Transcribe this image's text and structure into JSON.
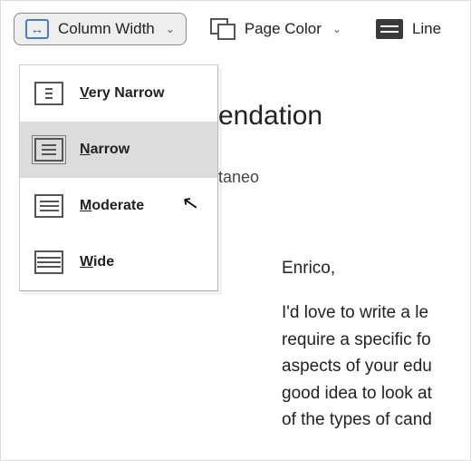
{
  "toolbar": {
    "column_width": {
      "label": "Column Width"
    },
    "page_color": {
      "label": "Page Color"
    },
    "line": {
      "label": "Line"
    }
  },
  "dropdown": {
    "items": [
      {
        "pre": "",
        "ul": "V",
        "rest": "ery Narrow"
      },
      {
        "pre": "",
        "ul": "N",
        "rest": "arrow"
      },
      {
        "pre": "",
        "ul": "M",
        "rest": "oderate"
      },
      {
        "pre": "",
        "ul": "W",
        "rest": "ide"
      }
    ],
    "selected_index": 1
  },
  "document": {
    "title_fragment": "endation",
    "author_fragment": "taneo",
    "greeting": "Enrico,",
    "body_lines": [
      "I'd love to write a le",
      "require a specific fo",
      "aspects of your edu",
      "good idea to look at",
      "of the types of cand"
    ]
  }
}
